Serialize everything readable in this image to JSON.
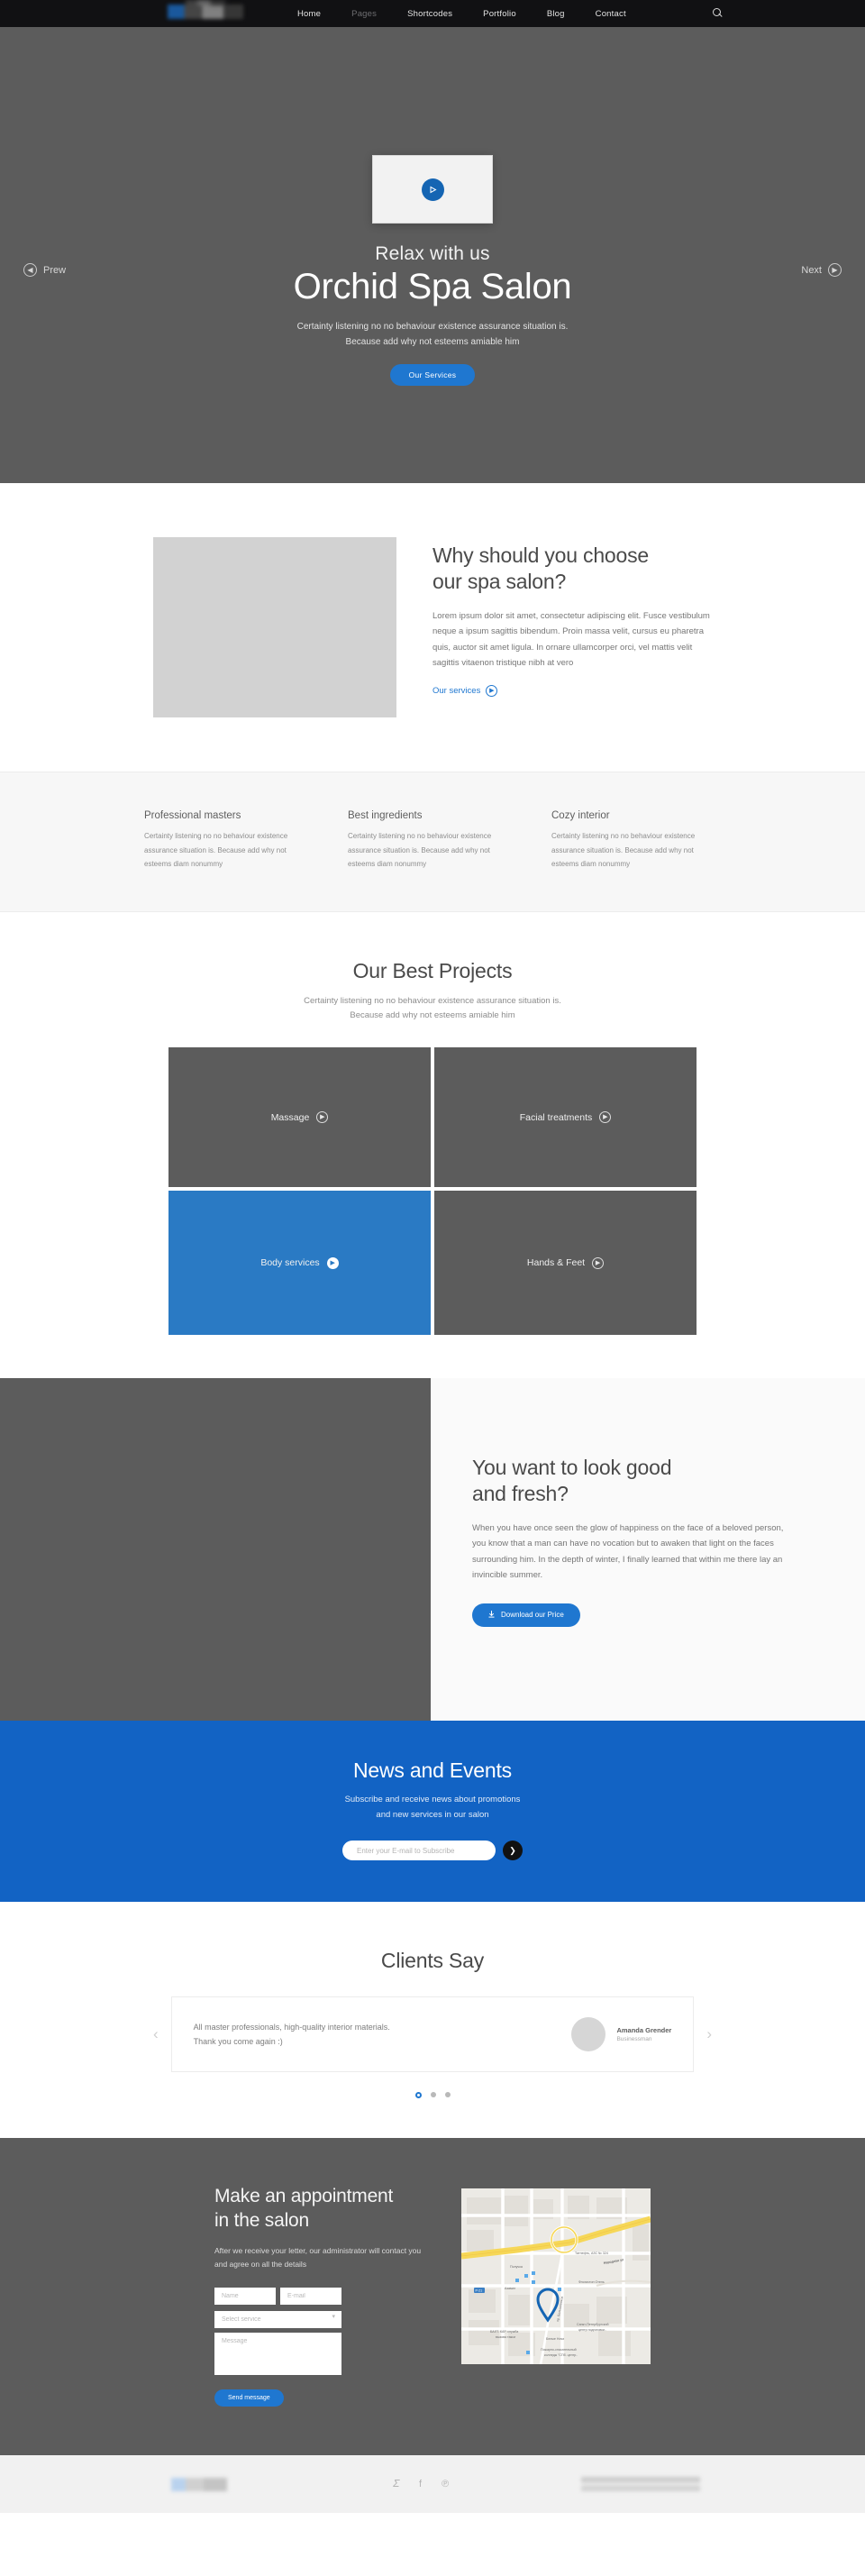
{
  "header": {
    "logo_alt": "site-logo",
    "nav": [
      {
        "label": "Home",
        "active": true
      },
      {
        "label": "Pages",
        "active": false
      },
      {
        "label": "Shortcodes",
        "active": false
      },
      {
        "label": "Portfolio",
        "active": false
      },
      {
        "label": "Blog",
        "active": false
      },
      {
        "label": "Contact",
        "active": false
      }
    ],
    "search_icon": "search-icon"
  },
  "hero": {
    "play_icon": "play-icon",
    "kicker": "Relax with us",
    "title": "Orchid Spa Salon",
    "subtitle_line1": "Certainty listening no no behaviour existence assurance situation is.",
    "subtitle_line2": "Because add why not esteems amiable him",
    "cta": "Our Services",
    "prev_label": "Prew",
    "next_label": "Next",
    "prev_icon": "chevron-left-icon",
    "next_icon": "chevron-right-icon",
    "bg_color": "#5c5c5c"
  },
  "why": {
    "image_alt": "spa-salon-photo",
    "title_line1": "Why should you choose",
    "title_line2": "our spa salon?",
    "body": "Lorem ipsum dolor sit amet, consectetur adipiscing elit. Fusce vestibulum neque a ipsum sagittis bibendum. Proin massa velit, cursus eu pharetra quis, auctor sit amet ligula. In ornare ullamcorper orci, vel mattis velit sagittis vitaenon tristique nibh at vero",
    "link": "Our services",
    "link_icon": "chevron-right-icon"
  },
  "features": [
    {
      "title": "Professional masters",
      "body": "Certainty listening no no behaviour existence assurance situation is. Because add why not esteems diam nonummy"
    },
    {
      "title": "Best ingredients",
      "body": "Certainty listening no no behaviour existence assurance situation is. Because add why not esteems diam nonummy"
    },
    {
      "title": "Cozy interior",
      "body": "Certainty listening no no behaviour existence assurance situation is. Because add why not esteems diam nonummy"
    }
  ],
  "projects": {
    "title": "Our Best Projects",
    "subtitle_line1": "Certainty listening no no behaviour existence assurance situation is.",
    "subtitle_line2": "Because add why not esteems amiable him",
    "items": [
      {
        "label": "Massage",
        "active": false,
        "icon": "chevron-right-icon"
      },
      {
        "label": "Facial treatments",
        "active": false,
        "icon": "chevron-right-icon"
      },
      {
        "label": "Body services",
        "active": true,
        "icon": "chevron-right-icon"
      },
      {
        "label": "Hands & Feet",
        "active": false,
        "icon": "chevron-right-icon"
      }
    ],
    "active_color": "#2a7ac4"
  },
  "lookgood": {
    "image_alt": "salon-interior-photo",
    "title_line1": "You want to look good",
    "title_line2": "and fresh?",
    "body": "When you have once seen the glow of happiness on the face of a beloved person, you know that a man can have no vocation but to awaken that light on the faces surrounding him. In the depth of winter, I finally learned that within me there lay an invincible summer.",
    "button": "Download our Price",
    "button_icon": "download-icon"
  },
  "newsletter": {
    "title": "News and Events",
    "subtitle_line1": "Subscribe and receive news about promotions",
    "subtitle_line2": "and new services in our salon",
    "placeholder": "Enter your E-mail to Subscribe",
    "value": "",
    "submit_icon": "arrow-right-icon",
    "bg_color": "#1263c4"
  },
  "clients": {
    "title": "Clients Say",
    "prev_icon": "chevron-left-icon",
    "next_icon": "chevron-right-icon",
    "testimonial": {
      "quote_line1": "All master professionals, high-quality interior materials.",
      "quote_line2": "Thank you come again :)",
      "avatar_alt": "client-avatar",
      "name": "Amanda Grender",
      "role": "Businessman"
    },
    "dots": [
      {
        "active": true
      },
      {
        "active": false
      },
      {
        "active": false
      }
    ]
  },
  "appointment": {
    "title_line1": "Make an appointment",
    "title_line2": "in the salon",
    "subtitle": "After we receive your letter, our administrator will contact you and agree on all the details",
    "fields": {
      "name_placeholder": "Name",
      "name_value": "",
      "email_placeholder": "E-mail",
      "email_value": "",
      "service_placeholder": "Select service",
      "service_value": "",
      "message_placeholder": "Message",
      "message_value": ""
    },
    "submit": "Send message",
    "map": {
      "alt": "location-map",
      "labels": [
        "Татнефть, АЗС № 324",
        "Народная ул",
        "Получка",
        "Азамат",
        "Р-21",
        "Флогистон Отель",
        "пр. Большевиков",
        "Санкт-Петербургский центр подготовки..",
        "БАЛТ. КАР. служба вызова такси",
        "Белые Ночи",
        "Пожарно-спасательный колледж \"СПб. центр.."
      ],
      "marker": "map-pin-icon"
    }
  },
  "footer": {
    "logo_alt": "footer-logo",
    "social": [
      {
        "name": "twitter-icon",
        "glyph": "𝒴"
      },
      {
        "name": "facebook-icon",
        "glyph": "f"
      },
      {
        "name": "pinterest-icon",
        "glyph": "℗"
      }
    ],
    "copyright_alt": "copyright-text"
  }
}
